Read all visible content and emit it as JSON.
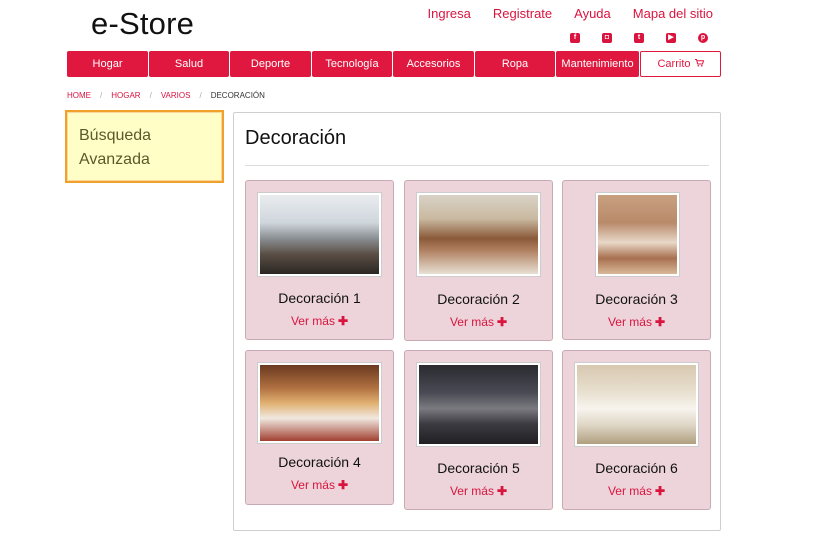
{
  "brand": {
    "logo": "e-Store"
  },
  "top_links": [
    "Ingresa",
    "Registrate",
    "Ayuda",
    "Mapa del sitio"
  ],
  "social_icons": [
    "facebook-icon",
    "instagram-icon",
    "twitter-icon",
    "youtube-icon",
    "pinterest-icon"
  ],
  "nav": {
    "items": [
      "Hogar",
      "Salud",
      "Deporte",
      "Tecnología",
      "Accesorios",
      "Ropa",
      "Mantenimiento"
    ],
    "cart_label": "Carrito",
    "cart_icon": "cart-icon"
  },
  "breadcrumb": {
    "links": [
      "HOME",
      "HOGAR",
      "VARIOS"
    ],
    "separator": "/",
    "current": "DECORACIÓN"
  },
  "sidebar": {
    "advanced_search": [
      "Búsqueda",
      "Avanzada"
    ]
  },
  "main": {
    "title": "Decoración",
    "more_label": "Ver más",
    "more_icon": "plus-icon",
    "products": [
      {
        "name": "Decoración 1"
      },
      {
        "name": "Decoración 2"
      },
      {
        "name": "Decoración 3"
      },
      {
        "name": "Decoración 4"
      },
      {
        "name": "Decoración 5"
      },
      {
        "name": "Decoración 6"
      }
    ]
  },
  "colors": {
    "accent": "#e0183f",
    "card_bg": "#ecd4da",
    "highlight_bg": "#fffec7",
    "highlight_border": "#f0a02b"
  }
}
